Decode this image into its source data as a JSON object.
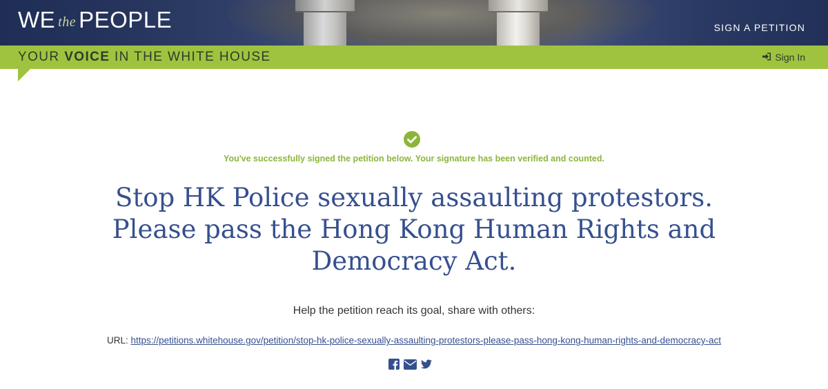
{
  "header": {
    "logo": {
      "we": "WE",
      "the": "the",
      "people": "PEOPLE"
    },
    "nav_sign_petition": "SIGN A PETITION"
  },
  "subheader": {
    "tagline_prefix": "YOUR",
    "tagline_bold": "VOICE",
    "tagline_suffix": "IN THE WHITE HOUSE",
    "sign_in": "Sign In"
  },
  "main": {
    "success_message": "You've successfully signed the petition below. Your signature has been verified and counted.",
    "petition_title": "Stop HK Police sexually assaulting protestors. Please pass the Hong Kong Human Rights and Democracy Act.",
    "share_prompt": "Help the petition reach its goal, share with others:",
    "url_label": "URL:",
    "url": "https://petitions.whitehouse.gov/petition/stop-hk-police-sexually-assaulting-protestors-please-pass-hong-kong-human-rights-and-democracy-act",
    "share_icons": [
      "facebook-icon",
      "email-icon",
      "twitter-icon"
    ]
  },
  "colors": {
    "accent_green": "#9fc33f",
    "success_green": "#8db53a",
    "title_blue": "#36508f",
    "link_blue": "#35508f"
  }
}
